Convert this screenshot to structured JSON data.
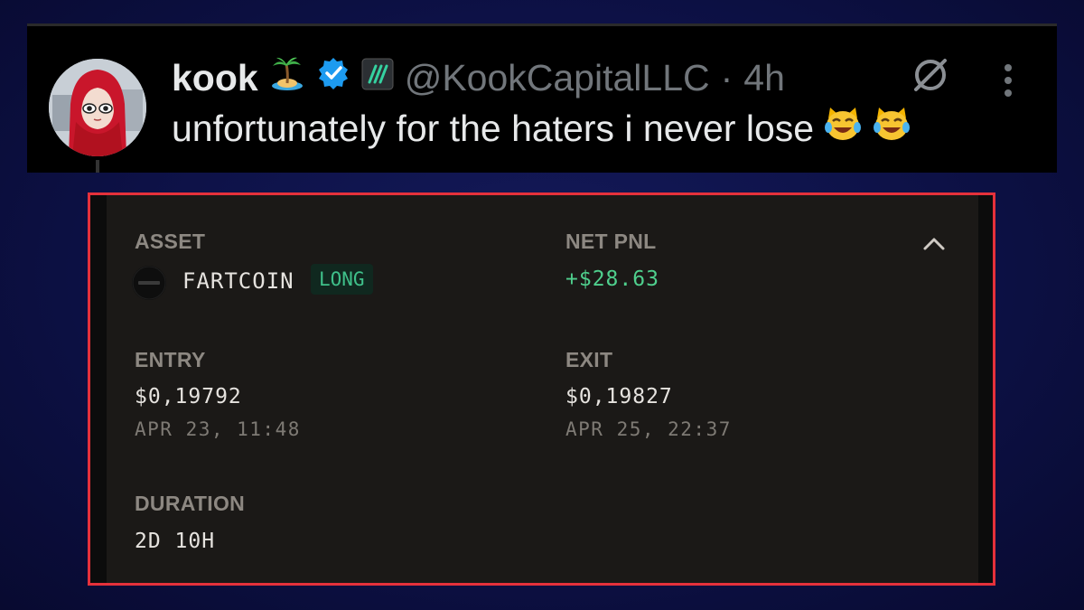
{
  "tweet": {
    "display_name": "kook",
    "name_emoji": "desert-island-icon",
    "handle": "@KookCapitalLLC",
    "separator": "·",
    "time": "4h",
    "text": "unfortunately for the haters i never lose",
    "text_emojis": [
      "cat-tears-of-joy-icon",
      "cat-tears-of-joy-icon"
    ]
  },
  "card": {
    "asset_label": "ASSET",
    "asset_name": "FARTCOIN",
    "side": "LONG",
    "net_pnl_label": "NET PNL",
    "net_pnl": "+$28.63",
    "entry_label": "ENTRY",
    "entry_price": "$0,19792",
    "entry_time": "APR 23, 11:48",
    "exit_label": "EXIT",
    "exit_price": "$0,19827",
    "exit_time": "APR 25, 22:37",
    "duration_label": "DURATION",
    "duration": "2D 10H"
  },
  "colors": {
    "verified": "#1d9bf0",
    "pnl_positive": "#4fcf8d",
    "highlight_border": "#e5313b"
  }
}
